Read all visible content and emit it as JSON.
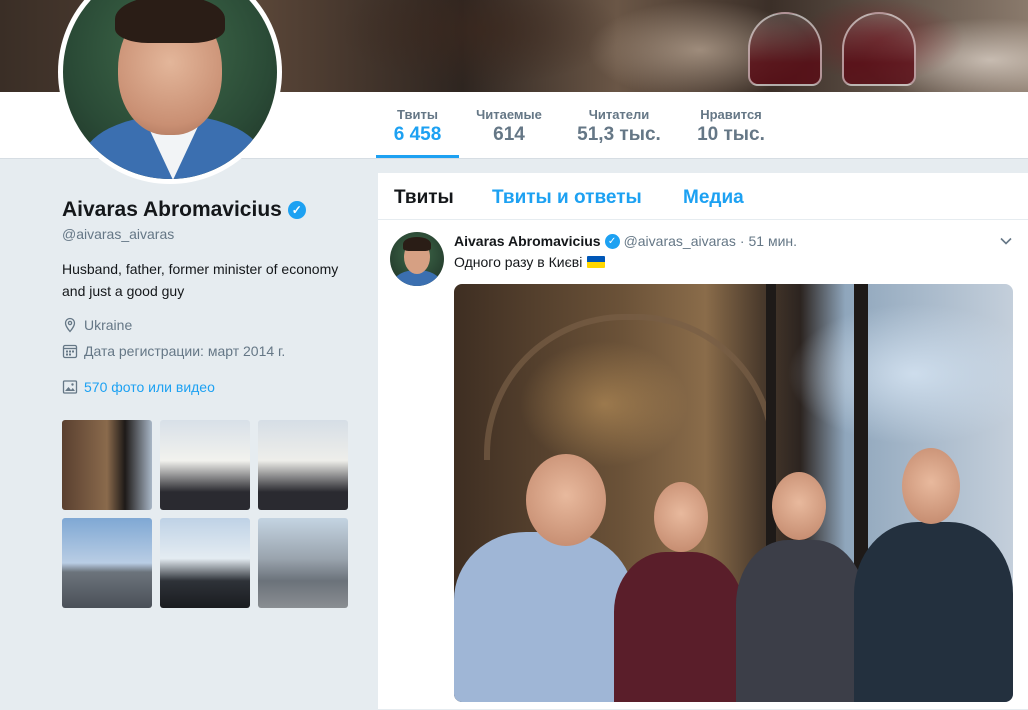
{
  "profile": {
    "name": "Aivaras Abromavicius",
    "verified_icon": "verified-badge-icon",
    "handle": "@aivaras_aivaras",
    "bio": "Husband, father, former minister of economy and just a good guy",
    "location": "Ukraine",
    "joined": "Дата регистрации: март 2014 г.",
    "photos_link": "570 фото или видео"
  },
  "stats": [
    {
      "label": "Твиты",
      "value": "6 458",
      "active": true
    },
    {
      "label": "Читаемые",
      "value": "614",
      "active": false
    },
    {
      "label": "Читатели",
      "value": "51,3 тыс.",
      "active": false
    },
    {
      "label": "Нравится",
      "value": "10 тыс.",
      "active": false
    }
  ],
  "tabs": [
    {
      "label": "Твиты",
      "active": true
    },
    {
      "label": "Твиты и ответы",
      "active": false
    },
    {
      "label": "Медиа",
      "active": false
    }
  ],
  "tweet": {
    "author": "Aivaras Abromavicius",
    "handle": "@aivaras_aivaras",
    "separator": "·",
    "time": "51 мин.",
    "text": "Одного разу в Києві"
  },
  "colors": {
    "accent": "#1da1f2",
    "background": "#e6ecf0",
    "muted": "#657786"
  }
}
